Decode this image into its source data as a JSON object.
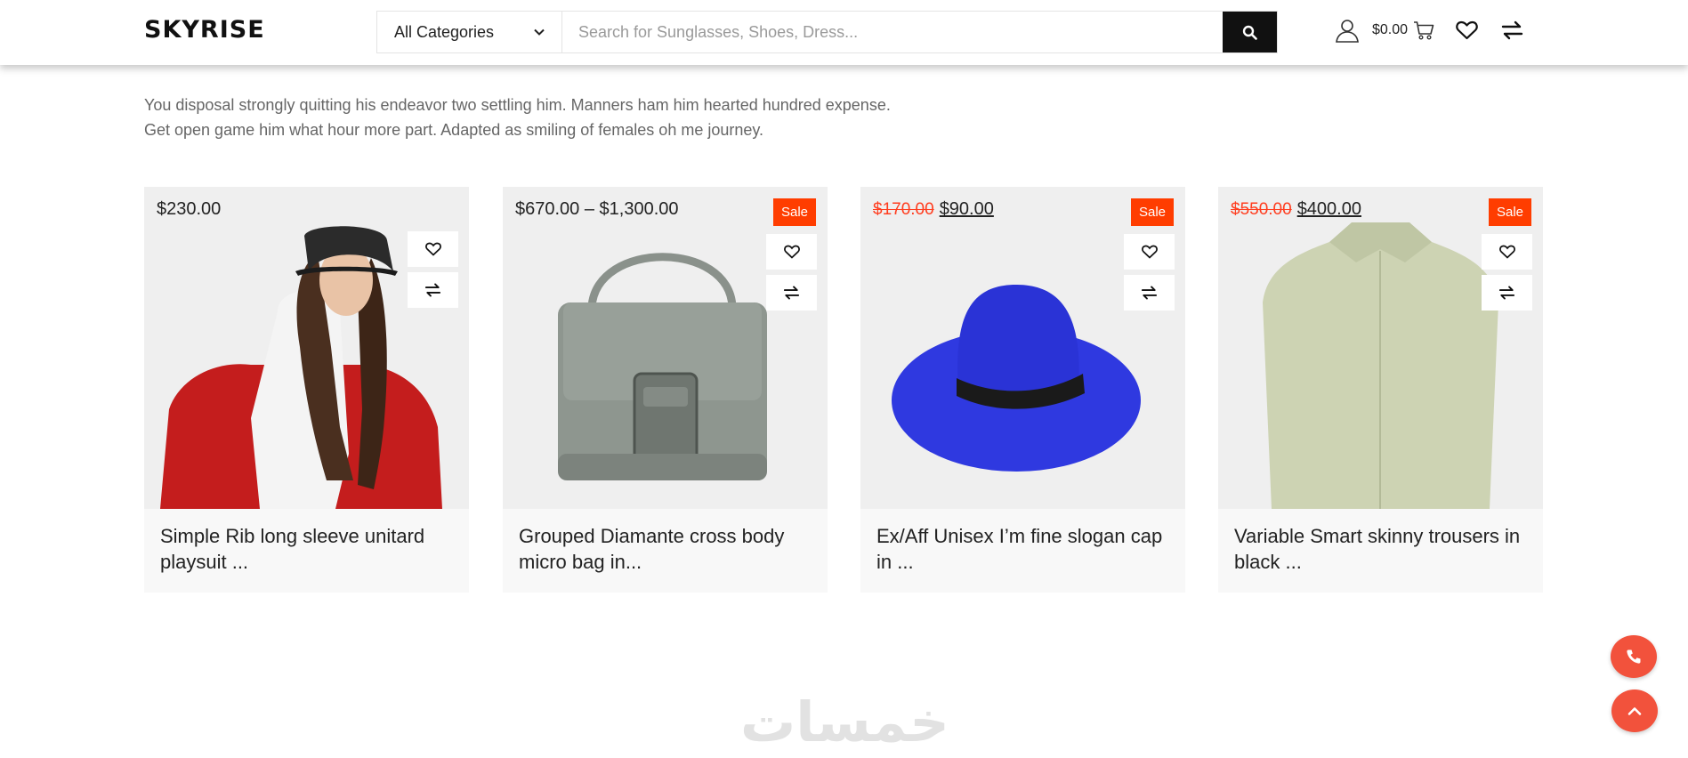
{
  "header": {
    "logo": "SKYRISE",
    "category": "All Categories",
    "search_placeholder": "Search for Sunglasses, Shoes, Dress...",
    "cart_total": "$0.00",
    "icons": [
      "user-icon",
      "cart-icon",
      "heart-icon",
      "compare-icon"
    ]
  },
  "intro": {
    "line1": "You disposal strongly quitting his endeavor two settling him. Manners ham him hearted hundred expense.",
    "line2": "Get open game him what hour more part. Adapted as smiling of females oh me journey."
  },
  "products": [
    {
      "price": "$230.00",
      "title_l1": "Simple Rib long sleeve unitard",
      "title_l2": "playsuit ..."
    },
    {
      "price": "$670.00 – $1,300.00",
      "sale": "Sale",
      "title_l1": "Grouped Diamante cross body",
      "title_l2": "micro bag in..."
    },
    {
      "old_price": "$170.00",
      "new_price": "$90.00",
      "sale": "Sale",
      "title_l1": "Ex/Aff Unisex I’m fine slogan cap",
      "title_l2": "in ..."
    },
    {
      "old_price": "$550.00",
      "new_price": "$400.00",
      "sale": "Sale",
      "title_l1": "Variable Smart skinny trousers in",
      "title_l2": "black ..."
    }
  ],
  "watermark": "خمسات",
  "colors": {
    "accent": "#ff3d00",
    "fab": "#f2523c",
    "search_button": "#111111"
  }
}
